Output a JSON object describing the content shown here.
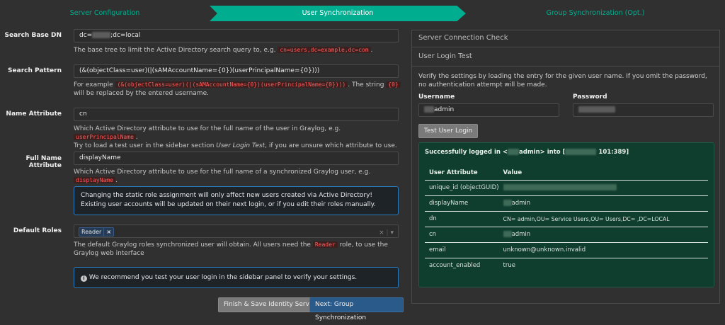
{
  "wizard": {
    "steps": [
      "Server Configuration",
      "User Synchronization",
      "Group Synchronization (Opt.)"
    ]
  },
  "form": {
    "search_base_dn": {
      "label": "Search Base DN",
      "value_prefix": "dc=",
      "value_suffix": ";dc=local",
      "help_text": "The base tree to limit the Active Directory search query to, e.g.",
      "help_code": "cn=users,dc=example,dc=com",
      "help_end": "."
    },
    "search_pattern": {
      "label": "Search Pattern",
      "value": "(&(objectClass=user)(|(sAMAccountName={0})(userPrincipalName={0})))",
      "help_prefix": "For example",
      "help_code": "(&(objectClass=user)(|(sAMAccountName={0})(userPrincipalName={0})))",
      "help_mid": ". The string",
      "help_code2": "{0}",
      "help_end": "will be replaced by the entered username."
    },
    "name_attribute": {
      "label": "Name Attribute",
      "value": "cn",
      "help_text": "Which Active Directory attribute to use for the full name of the user in Graylog, e.g.",
      "help_code": "userPrincipalName",
      "help_end": ".",
      "help_line2_prefix": "Try to load a test user in the sidebar section",
      "help_line2_em": "User Login Test",
      "help_line2_end": ", if you are unsure which attribute to use."
    },
    "full_name_attribute": {
      "label": "Full Name Attribute",
      "value": "displayName",
      "help_text": "Which Active Directory attribute to use for the full name of a synchronized Graylog user, e.g.",
      "help_code": "displayName",
      "help_end": "."
    },
    "role_alert": "Changing the static role assignment will only affect new users created via Active Directory! Existing user accounts will be updated on their next login, or if you edit their roles manually.",
    "default_roles": {
      "label": "Default Roles",
      "tag": "Reader",
      "tag_remove": "×",
      "clear": "×",
      "help_prefix": "The default Graylog roles synchronized user will obtain. All users need the",
      "help_code": "Reader",
      "help_end": "role, to use the Graylog web interface"
    },
    "info_alert": "We recommend you test your user login in the sidebar panel to verify your settings.",
    "buttons": {
      "finish": "Finish & Save Identity Service",
      "next": "Next: Group Synchronization"
    }
  },
  "sidebar": {
    "connection_check": "Server Connection Check",
    "login_test": "User Login Test",
    "description": "Verify the settings by loading the entry for the given user name. If you omit the password, no authentication attempt will be made.",
    "username_label": "Username",
    "username_value": "admin",
    "password_label": "Password",
    "test_button": "Test User Login",
    "result": {
      "title_prefix": "Successfully logged in <",
      "title_mid": "admin> into [",
      "title_suffix": "101:389]",
      "col_attr": "User Attribute",
      "col_value": "Value",
      "rows": [
        {
          "attr": "unique_id (objectGUID)",
          "value": ""
        },
        {
          "attr": "displayName",
          "value": "admin"
        },
        {
          "attr": "dn",
          "value": "CN=  admin,OU=  Service Users,OU=  Users,DC=  ,DC=LOCAL"
        },
        {
          "attr": "cn",
          "value": "admin"
        },
        {
          "attr": "email",
          "value": "unknown@unknown.invalid"
        },
        {
          "attr": "account_enabled",
          "value": "true"
        }
      ]
    }
  },
  "colors": {
    "accent": "#00ad8f",
    "success_bg": "#0f3d2e",
    "info_border": "#2a7bbd",
    "code_red": "#ff5a5a"
  }
}
